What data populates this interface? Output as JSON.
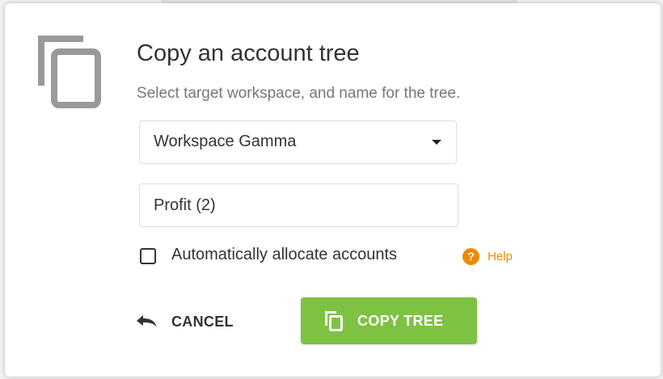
{
  "dialog": {
    "title": "Copy an account tree",
    "subtitle": "Select target workspace, and name for the tree.",
    "icon": "copy-icon",
    "workspace_select": {
      "value": "Workspace Gamma",
      "icon": "caret-down-icon"
    },
    "tree_name_input": {
      "value": "Profit (2)"
    },
    "auto_allocate": {
      "label": "Automatically allocate accounts",
      "checked": false
    },
    "help": {
      "badge": "?",
      "label": "Help",
      "color": "#ee8a00"
    },
    "cancel": {
      "label": "CANCEL",
      "icon": "undo-icon"
    },
    "copy": {
      "label": "COPY TREE",
      "icon": "copy-icon",
      "color": "#7ec242"
    }
  }
}
